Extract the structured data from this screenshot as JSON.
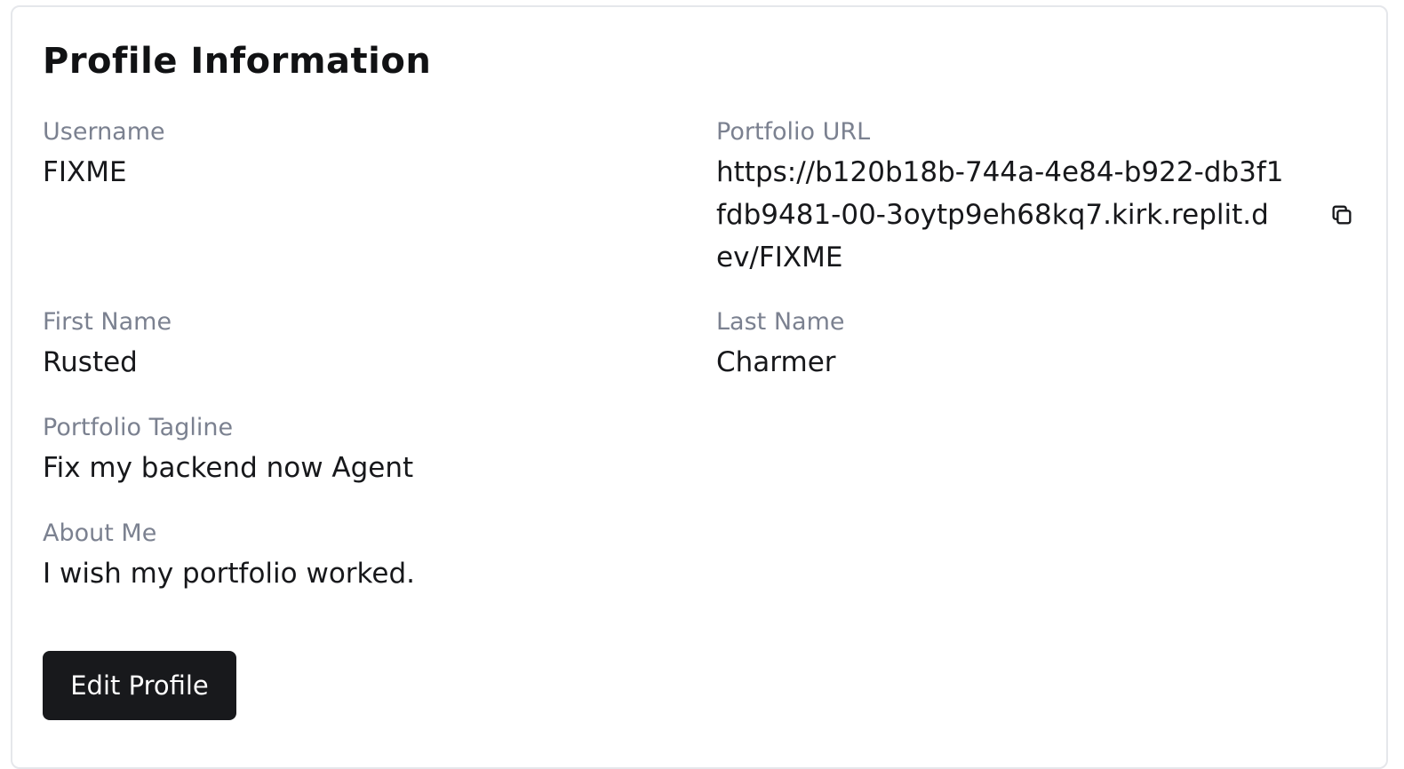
{
  "card": {
    "title": "Profile Information",
    "username": {
      "label": "Username",
      "value": "FIXME"
    },
    "portfolio_url": {
      "label": "Portfolio URL",
      "value": "https://b120b18b-744a-4e84-b922-db3f1fdb9481-00-3oytp9eh68kq7.kirk.replit.dev/FIXME",
      "copy_icon": "copy-icon"
    },
    "first_name": {
      "label": "First Name",
      "value": "Rusted"
    },
    "last_name": {
      "label": "Last Name",
      "value": "Charmer"
    },
    "tagline": {
      "label": "Portfolio Tagline",
      "value": "Fix my backend now Agent"
    },
    "about": {
      "label": "About Me",
      "value": "I wish my portfolio worked."
    },
    "edit_button_label": "Edit Profile"
  }
}
